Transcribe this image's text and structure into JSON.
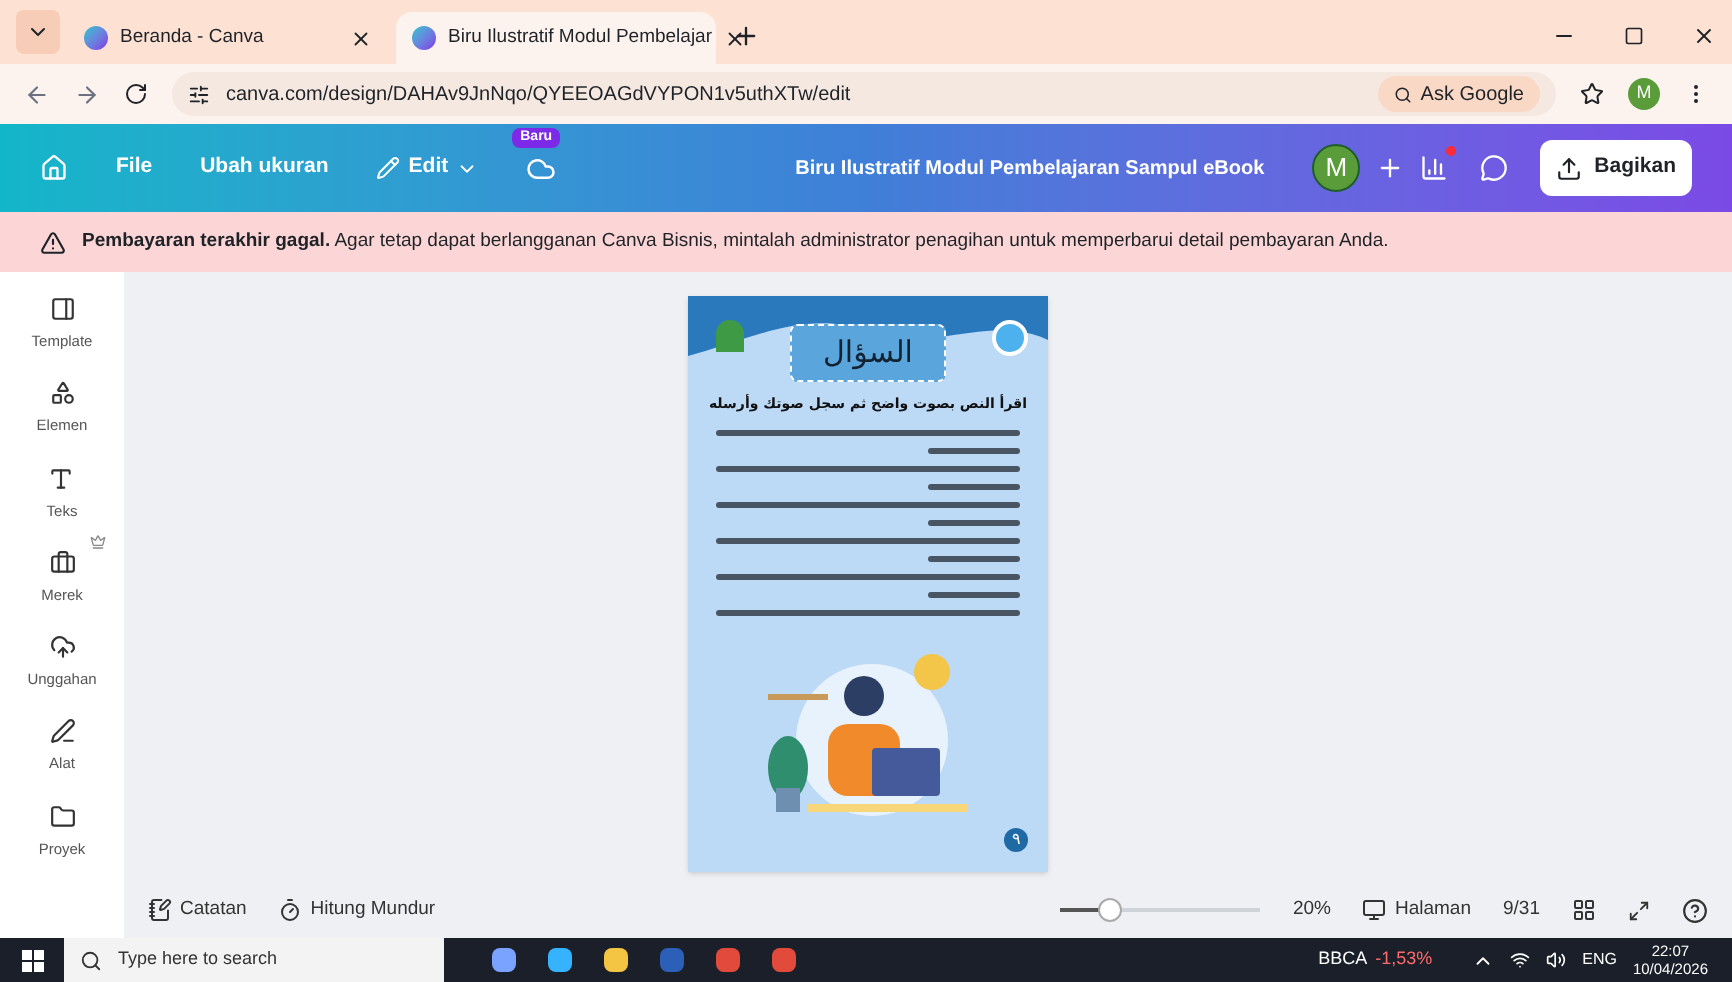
{
  "browser": {
    "tabs": [
      {
        "title": "Beranda - Canva",
        "selected": false
      },
      {
        "title": "Biru Ilustratif Modul Pembelajar",
        "selected": true
      }
    ],
    "address": "canva.com/design/DAHAv9JnNqo/QYEEOAGdVYPON1v5uthXTw/edit",
    "ask_google": "Ask Google",
    "profile_initial": "M"
  },
  "toolbar": {
    "menu": [
      "File",
      "Ubah ukuran",
      "Edit"
    ],
    "badge": "Baru",
    "title": "Biru Ilustratif Modul Pembelajaran Sampul eBook",
    "avatar_initial": "M",
    "notification": true,
    "share": "Bagikan"
  },
  "alert": {
    "text": "**Pembayaran terakhir gagal.** Agar tetap dapat berlangganan Canva Bisnis, mintalah administrator penagihan untuk memperbarui detail pembayaran Anda."
  },
  "sidebar": {
    "items": [
      {
        "label": "Template"
      },
      {
        "label": "Elemen"
      },
      {
        "label": "Teks"
      },
      {
        "label": "Merek",
        "premium": true
      },
      {
        "label": "Unggahan"
      },
      {
        "label": "Alat"
      },
      {
        "label": "Proyek"
      }
    ]
  },
  "page": {
    "title": "السؤال",
    "instruction": "اقرأ النص بصوت واضح ثم سجل صوتك وأرسله",
    "page_number": "٩"
  },
  "footer": {
    "notes": "Catatan",
    "timer": "Hitung Mundur",
    "zoom": {
      "level": 0.25,
      "reading": "20%"
    },
    "pages": "Halaman",
    "page_count": "9/31"
  },
  "taskbar": {
    "search_placeholder": "Type here to search",
    "stock": {
      "name": "BBCA",
      "change": "-1,53%"
    },
    "language": "ENG",
    "time": "22:07",
    "date": "10/04/2026"
  }
}
